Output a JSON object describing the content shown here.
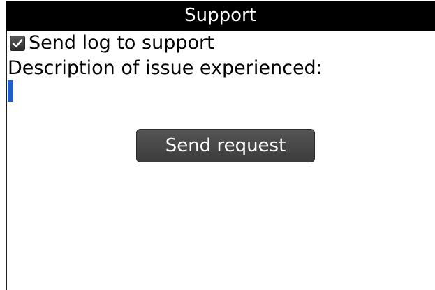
{
  "screen": {
    "title": "Support"
  },
  "form": {
    "send_log": {
      "label": "Send log to support",
      "checked": true,
      "check_icon": "checkmark-icon"
    },
    "description": {
      "label": "Description of issue experienced:",
      "value": ""
    },
    "send_button_label": "Send request"
  },
  "colors": {
    "title_bar_bg": "#000000",
    "title_text": "#ffffff",
    "caret": "#1f5fc8",
    "button_bg": "#474747",
    "button_text": "#ffffff"
  }
}
